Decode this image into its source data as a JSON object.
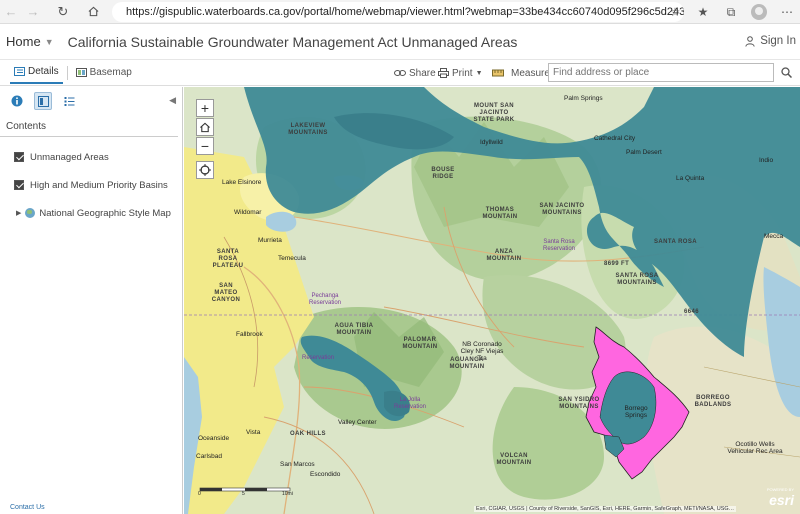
{
  "browser": {
    "url": "https://gispublic.waterboards.ca.gov/portal/home/webmap/viewer.html?webmap=33be434cc60740d095f296c5d24328…"
  },
  "header": {
    "home_label": "Home",
    "title": "California Sustainable Groundwater Management Act Unmanaged Areas",
    "signin_label": "Sign In"
  },
  "toolbar": {
    "details_label": "Details",
    "basemap_label": "Basemap",
    "share_label": "Share",
    "print_label": "Print",
    "measure_label": "Measure",
    "search_placeholder": "Find address or place"
  },
  "sidebar": {
    "contents_label": "Contents",
    "layers": [
      {
        "label": "Unmanaged Areas",
        "checked": true
      },
      {
        "label": "High and Medium Priority Basins",
        "checked": true
      }
    ],
    "basemap_layer": "National Geographic Style Map",
    "contact_label": "Contact Us"
  },
  "map": {
    "zoom_in": "+",
    "zoom_out": "−",
    "colors": {
      "unmanaged": "#3f8a96",
      "priority": "#ff66e0",
      "terrain": "#d9e4c6",
      "forest": "#a8c98e",
      "urban": "#f2ea8a",
      "water": "#a8cde0"
    },
    "labels": {
      "palm_springs": "Palm Springs",
      "cathedral_city": "Cathedral City",
      "palm_desert": "Palm Desert",
      "la_quinta": "La Quinta",
      "indio": "Indio",
      "mount_san_jacinto": "Mount San Jacinto State Park",
      "idyllwild": "Idyllwild",
      "thomas_mountain": "THOMAS MOUNTAIN",
      "san_jacinto_mountains": "SAN JACINTO MOUNTAINS",
      "santa_rosa_res": "Santa Rosa Reservation",
      "anza_mountain": "ANZA MOUNTAIN",
      "santa_rosa_mountains": "SANTA ROSA MOUNTAINS",
      "lakeview_mountains": "LAKEVIEW MOUNTAINS",
      "bouse_ridge": "BOUSE RIDGE",
      "elsinore": "Lake Elsinore",
      "wildomar": "Wildomar",
      "murrieta": "Murrieta",
      "temecula": "Temecula",
      "santa_rosa_plateau": "SANTA ROSA PLATEAU",
      "san_mateo_canyon": "SAN MATEO CANYON",
      "pechanga": "Pechanga Reservation",
      "agua_tibia": "AGUA TIBIA MOUNTAIN",
      "fallbrook": "Fallbrook",
      "palomar": "PALOMAR MOUNTAIN",
      "aguanga": "AGUANGA MOUNTAIN",
      "cleveland": "NB Coronado Cley NF Viejas Tra",
      "reservation": "Reservation",
      "la_jolla": "La Jolla Reservation",
      "oceanside": "Oceanside",
      "vista": "Vista",
      "carlsbad": "Carlsbad",
      "oak_hills": "OAK HILLS",
      "valley_center": "Valley Center",
      "san_marcos": "San Marcos",
      "escondido": "Escondido",
      "volcan": "VOLCAN MOUNTAIN",
      "san_ysidro": "SAN YSIDRO MOUNTAINS",
      "borrego_springs": "Borrego Springs",
      "borrego_badlands": "BORREGO BADLANDS",
      "ocotillo_wells": "Ocotillo Wells Vehicular Rec Area",
      "mecca": "Mecca",
      "elev1": "8699 ft",
      "elev2": "6646",
      "santa_rosa_hills": "SANTA ROSA"
    },
    "attribution": "Esri, CGIAR, USGS | County of Riverside, SanGIS, Esri, HERE, Garmin, SafeGraph, METI/NASA, USG…",
    "esri_logo": "esri",
    "powered_by": "POWERED BY",
    "scale_labels": [
      "0",
      "5",
      "10mi"
    ]
  }
}
